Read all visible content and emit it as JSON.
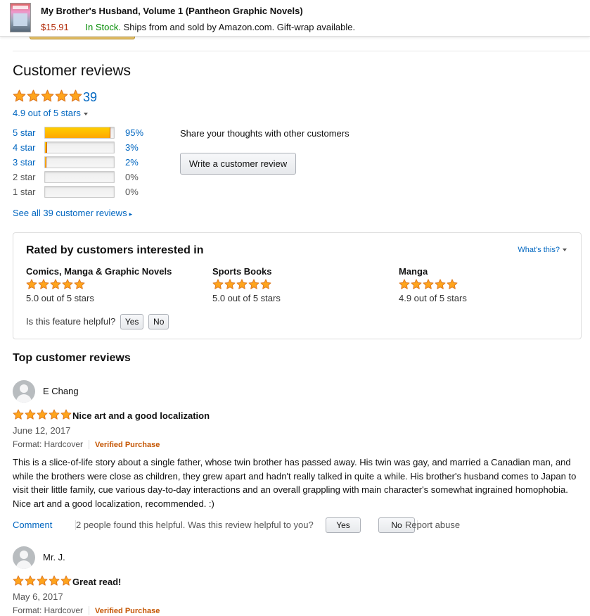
{
  "product_bar": {
    "title": "My Brother's Husband, Volume 1 (Pantheon Graphic Novels)",
    "price": "$15.91",
    "stock": "In Stock.",
    "shipping": "Ships from and sold by Amazon.com. Gift-wrap available."
  },
  "reviews_summary": {
    "heading": "Customer reviews",
    "total_count": "39",
    "average_text": "4.9 out of 5 stars",
    "average_stars": 4.9,
    "histogram": [
      {
        "label": "5 star",
        "percent_text": "95%",
        "percent": 95
      },
      {
        "label": "4 star",
        "percent_text": "3%",
        "percent": 3
      },
      {
        "label": "3 star",
        "percent_text": "2%",
        "percent": 2
      },
      {
        "label": "2 star",
        "percent_text": "0%",
        "percent": 0
      },
      {
        "label": "1 star",
        "percent_text": "0%",
        "percent": 0
      }
    ],
    "see_all": "See all 39 customer reviews",
    "share_text": "Share your thoughts with other customers",
    "write_review": "Write a customer review"
  },
  "rated_by": {
    "title": "Rated by customers interested in",
    "whats_this": "What's this?",
    "categories": [
      {
        "name": "Comics, Manga & Graphic Novels",
        "rating_text": "5.0 out of 5 stars",
        "stars": 5.0
      },
      {
        "name": "Sports Books",
        "rating_text": "5.0 out of 5 stars",
        "stars": 5.0
      },
      {
        "name": "Manga",
        "rating_text": "4.9 out of 5 stars",
        "stars": 4.9
      }
    ],
    "helpful_question": "Is this feature helpful?",
    "yes": "Yes",
    "no": "No"
  },
  "top_reviews": {
    "heading": "Top customer reviews",
    "reviews": [
      {
        "author": "E Chang",
        "stars": 5,
        "title": "Nice art and a good localization",
        "date": "June 12, 2017",
        "format": "Format: Hardcover",
        "verified": "Verified Purchase",
        "body": "This is a slice-of-life story about a single father, whose twin brother has passed away. His twin was gay, and married a Canadian man, and while the brothers were close as children, they grew apart and hadn't really talked in quite a while. His brother's husband comes to Japan to visit their little family, cue various day-to-day interactions and an overall grappling with main character's somewhat ingrained homophobia. Nice art and a good localization, recommended. :)",
        "comment": "Comment",
        "helpful_text": "2 people found this helpful. Was this review helpful to you?",
        "yes": "Yes",
        "no": "No",
        "report": "Report abuse"
      },
      {
        "author": "Mr. J.",
        "stars": 5,
        "title": "Great read!",
        "date": "May 6, 2017",
        "format": "Format: Hardcover",
        "verified": "Verified Purchase"
      }
    ]
  },
  "colors": {
    "star": "#ffa41c",
    "star_stroke": "#de7921",
    "link": "#0066c0",
    "price": "#b12704",
    "in_stock": "#008a00",
    "verified": "#c45500"
  }
}
